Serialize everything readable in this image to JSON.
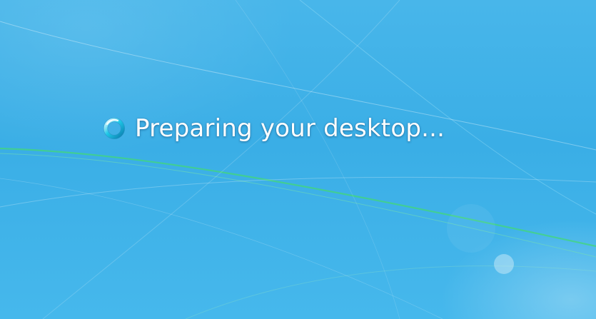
{
  "logon_screen": {
    "status_message": "Preparing your desktop...",
    "busy_indicator_icon": "busy-spinner-icon"
  },
  "colors": {
    "background": "#3aaee6",
    "text": "#ffffff",
    "streak_green": "#3fd67a",
    "streak_white": "#ffffff",
    "spinner_accent": "#1fc8e8"
  }
}
